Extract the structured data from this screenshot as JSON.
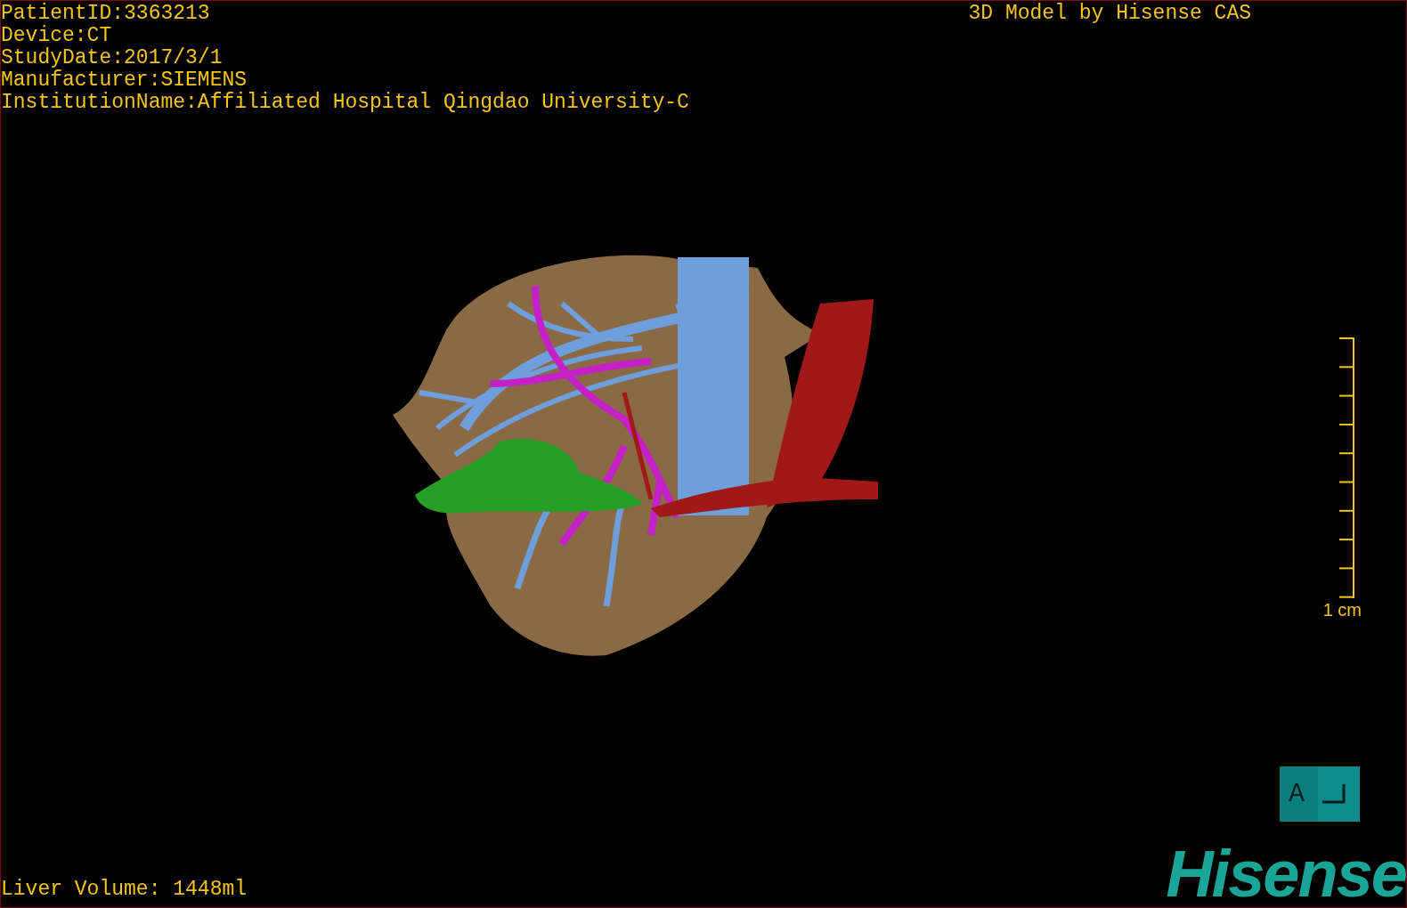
{
  "patient_info": [
    "PatientID:3363213",
    "Device:CT",
    "StudyDate:2017/3/1",
    "Manufacturer:SIEMENS",
    "InstitutionName:Affiliated Hospital Qingdao University-C"
  ],
  "title": "3D Model by Hisense CAS",
  "scale_bar": {
    "label": "1 cm"
  },
  "orientation_marker": {
    "label": "A"
  },
  "liver_volume": "Liver Volume: 1448ml",
  "logo": "Hisense"
}
